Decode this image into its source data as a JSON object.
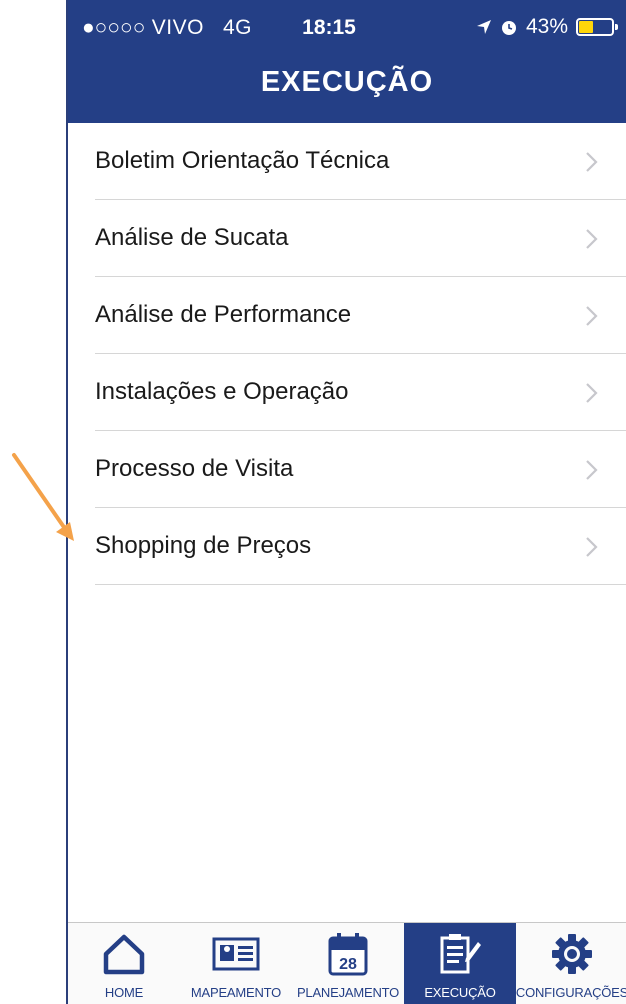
{
  "status_bar": {
    "signal": "●○○○○",
    "carrier": "VIVO",
    "network": "4G",
    "time": "18:15",
    "battery_percent": "43%",
    "battery_level": 0.43
  },
  "header": {
    "title": "EXECUÇÃO"
  },
  "menu": {
    "items": [
      {
        "label": "Boletim Orientação Técnica"
      },
      {
        "label": "Análise de Sucata"
      },
      {
        "label": "Análise de Performance"
      },
      {
        "label": "Instalações e Operação"
      },
      {
        "label": "Processo de Visita"
      },
      {
        "label": "Shopping de Preços"
      }
    ]
  },
  "tabbar": {
    "items": [
      {
        "label": "HOME",
        "icon": "home-icon"
      },
      {
        "label": "MAPEAMENTO",
        "icon": "id-card-icon"
      },
      {
        "label": "PLANEJAMENTO",
        "icon": "calendar-icon",
        "calendar_day": "28"
      },
      {
        "label": "EXECUÇÃO",
        "icon": "edit-document-icon",
        "active": true
      },
      {
        "label": "CONFIGURAÇÕES",
        "icon": "gear-icon"
      }
    ]
  },
  "colors": {
    "primary": "#243f86",
    "battery": "#ffd60a",
    "annotation_arrow": "#f4a24a"
  }
}
